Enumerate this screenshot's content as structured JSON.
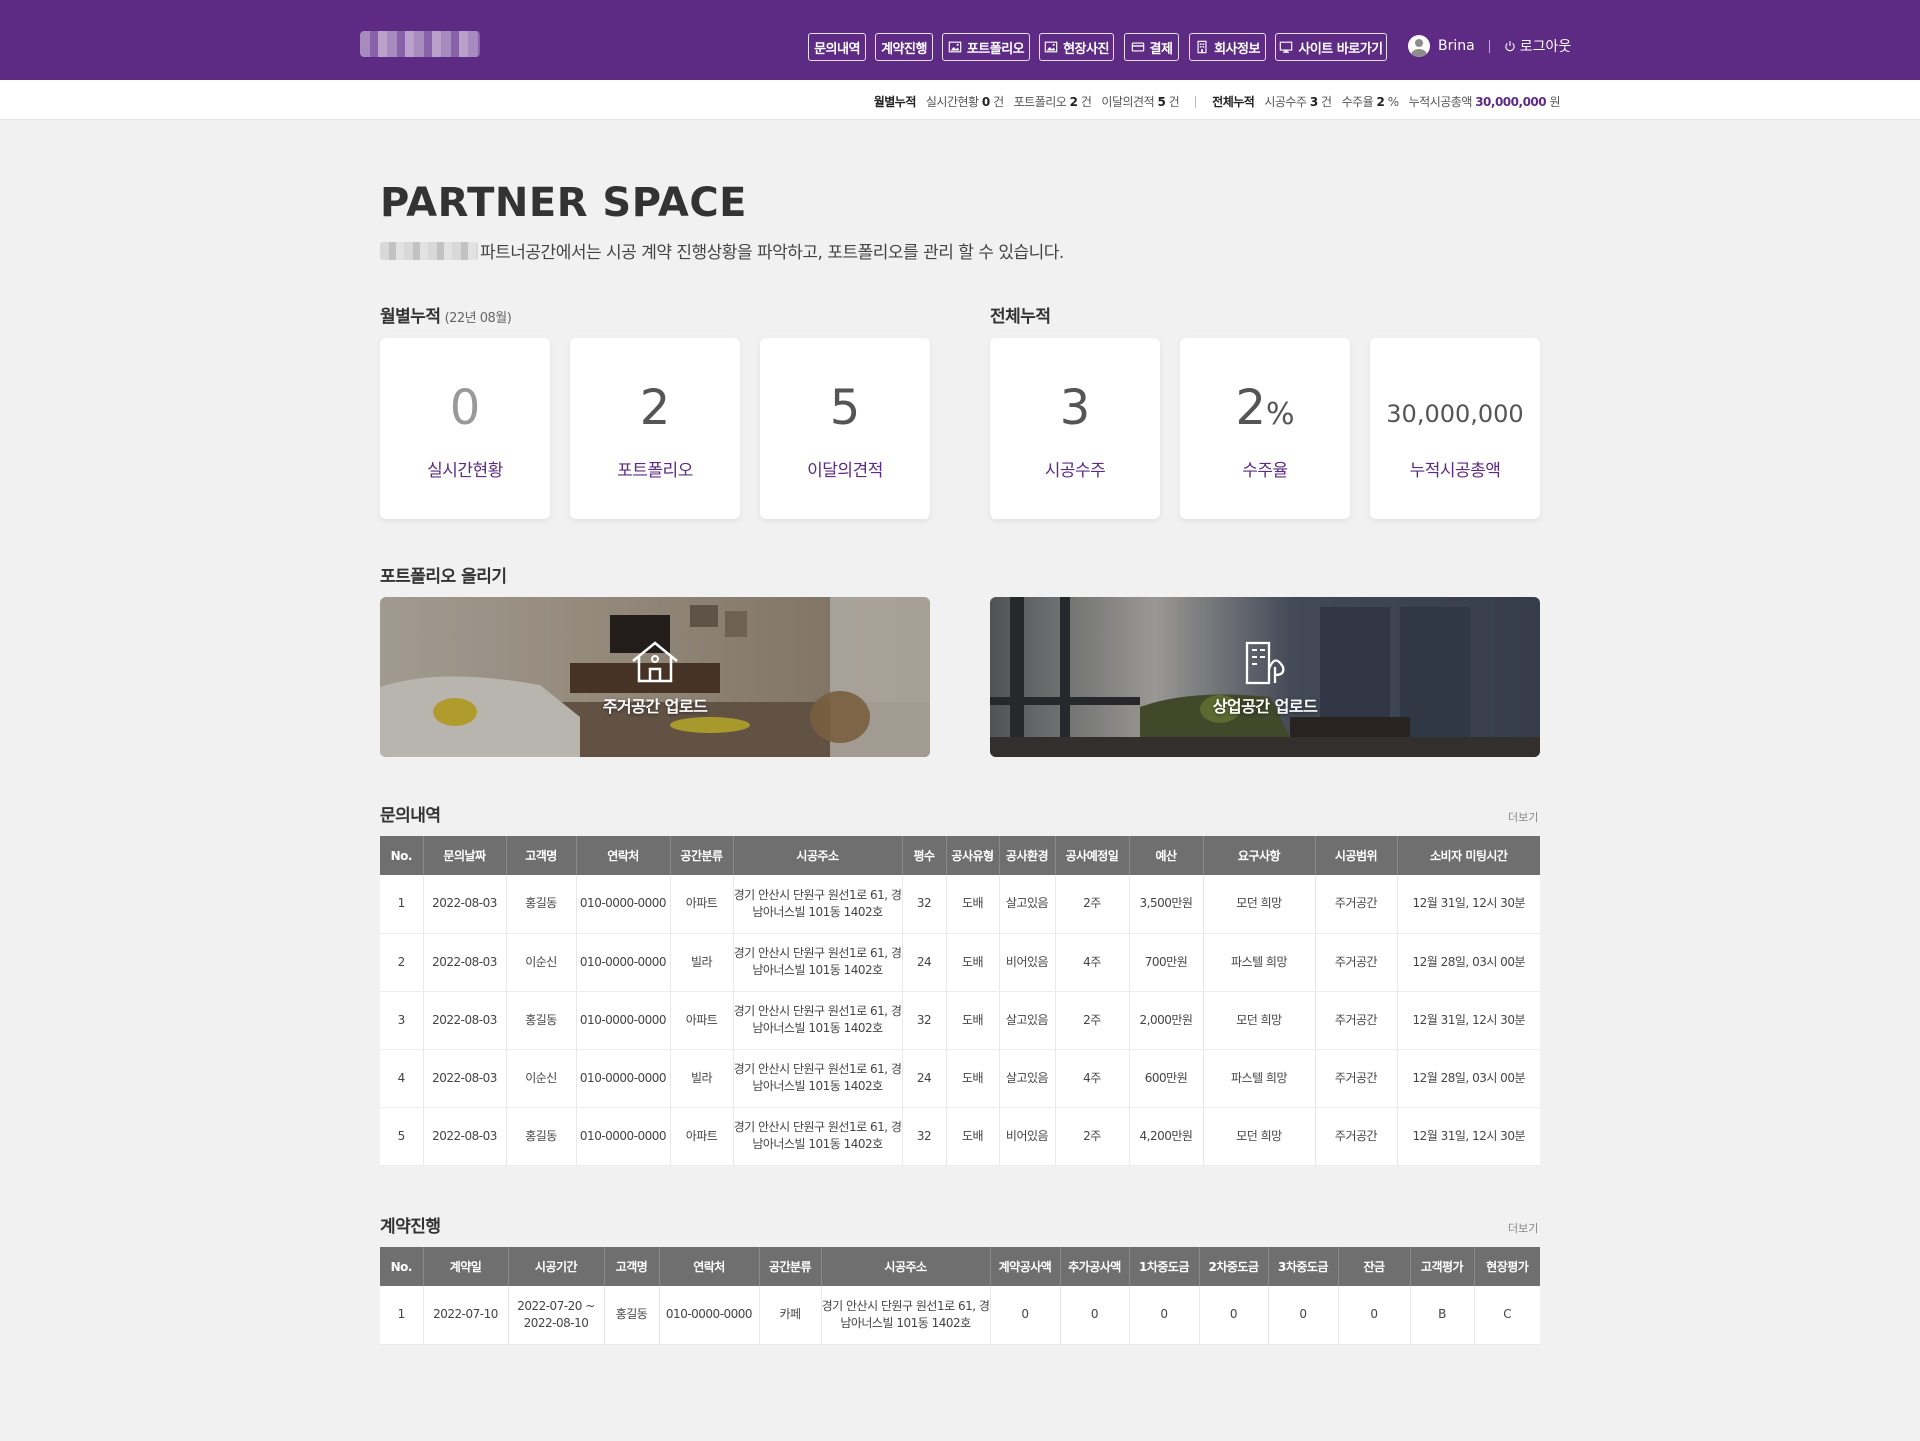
{
  "header": {
    "nav": [
      {
        "label": "문의내역",
        "icon": ""
      },
      {
        "label": "계약진행",
        "icon": ""
      },
      {
        "label": "포트폴리오",
        "icon": "image-icon"
      },
      {
        "label": "현장사진",
        "icon": "image-icon"
      },
      {
        "label": "결제",
        "icon": "card-icon"
      },
      {
        "label": "회사정보",
        "icon": "building-icon"
      },
      {
        "label": "사이트 바로가기",
        "icon": "monitor-icon"
      }
    ],
    "user_name": "Brina",
    "logout_label": "로그아웃"
  },
  "statbar": {
    "monthly_title": "월별누적",
    "realtime_label": "실시간현황",
    "realtime_value": "0",
    "realtime_unit": "건",
    "portfolio_label": "포트폴리오",
    "portfolio_value": "2",
    "portfolio_unit": "건",
    "quote_label": "이달의견적",
    "quote_value": "5",
    "quote_unit": "건",
    "total_title": "전체누적",
    "orders_label": "시공수주",
    "orders_value": "3",
    "orders_unit": "건",
    "rate_label": "수주율",
    "rate_value": "2",
    "rate_unit": "%",
    "amount_label": "누적시공총액",
    "amount_value": "30,000,000",
    "amount_unit": "원"
  },
  "page": {
    "title": "PARTNER SPACE",
    "subtitle": "파트너공간에서는 시공 계약 진행상황을 파악하고, 포트폴리오를 관리 할 수 있습니다."
  },
  "monthly": {
    "title": "월별누적",
    "period": "(22년 08월)",
    "cards": [
      {
        "value": "0",
        "label": "실시간현황"
      },
      {
        "value": "2",
        "label": "포트폴리오"
      },
      {
        "value": "5",
        "label": "이달의견적"
      }
    ]
  },
  "total": {
    "title": "전체누적",
    "cards": [
      {
        "value": "3",
        "label": "시공수주"
      },
      {
        "value": "2",
        "suffix": "%",
        "label": "수주율"
      },
      {
        "value": "30,000,000",
        "label": "누적시공총액"
      }
    ]
  },
  "upload": {
    "title": "포트폴리오 올리기",
    "residential_label": "주거공간 업로드",
    "commercial_label": "상업공간 업로드"
  },
  "inquiries": {
    "title": "문의내역",
    "more_label": "더보기",
    "columns": [
      "No.",
      "문의날짜",
      "고객명",
      "연락처",
      "공간분류",
      "시공주소",
      "평수",
      "공사유형",
      "공사환경",
      "공사예정일",
      "예산",
      "요구사항",
      "시공범위",
      "소비자 미팅시간"
    ],
    "rows": [
      [
        "1",
        "2022-08-03",
        "홍길동",
        "010-0000-0000",
        "아파트",
        "경기 안산시 단원구 원선1로 61, 경남아너스빌 101동 1402호",
        "32",
        "도배",
        "살고있음",
        "2주",
        "3,500만원",
        "모던 희망",
        "주거공간",
        "12월 31일, 12시 30분"
      ],
      [
        "2",
        "2022-08-03",
        "이순신",
        "010-0000-0000",
        "빌라",
        "경기 안산시 단원구 원선1로 61, 경남아너스빌 101동 1402호",
        "24",
        "도배",
        "비어있음",
        "4주",
        "700만원",
        "파스텔 희망",
        "주거공간",
        "12월 28일, 03시 00분"
      ],
      [
        "3",
        "2022-08-03",
        "홍길동",
        "010-0000-0000",
        "아파트",
        "경기 안산시 단원구 원선1로 61, 경남아너스빌 101동 1402호",
        "32",
        "도배",
        "살고있음",
        "2주",
        "2,000만원",
        "모던 희망",
        "주거공간",
        "12월 31일, 12시 30분"
      ],
      [
        "4",
        "2022-08-03",
        "이순신",
        "010-0000-0000",
        "빌라",
        "경기 안산시 단원구 원선1로 61, 경남아너스빌 101동 1402호",
        "24",
        "도배",
        "살고있음",
        "4주",
        "600만원",
        "파스텔 희망",
        "주거공간",
        "12월 28일, 03시 00분"
      ],
      [
        "5",
        "2022-08-03",
        "홍길동",
        "010-0000-0000",
        "아파트",
        "경기 안산시 단원구 원선1로 61, 경남아너스빌 101동 1402호",
        "32",
        "도배",
        "비어있음",
        "2주",
        "4,200만원",
        "모던 희망",
        "주거공간",
        "12월 31일, 12시 30분"
      ]
    ]
  },
  "contracts": {
    "title": "계약진행",
    "more_label": "더보기",
    "columns": [
      "No.",
      "계약일",
      "시공기간",
      "고객명",
      "연락처",
      "공간분류",
      "시공주소",
      "계약공사액",
      "추가공사액",
      "1차중도금",
      "2차중도금",
      "3차중도금",
      "잔금",
      "고객평가",
      "현장평가"
    ],
    "rows": [
      [
        "1",
        "2022-07-10",
        "2022-07-20 ~ 2022-08-10",
        "홍길동",
        "010-0000-0000",
        "카페",
        "경기 안산시 단원구 원선1로 61, 경남아너스빌 101동 1402호",
        "0",
        "0",
        "0",
        "0",
        "0",
        "0",
        "B",
        "C"
      ]
    ]
  },
  "colors": {
    "brand": "#5e2b84",
    "table_header": "#6f6f6f",
    "background": "#f1f1f1"
  }
}
